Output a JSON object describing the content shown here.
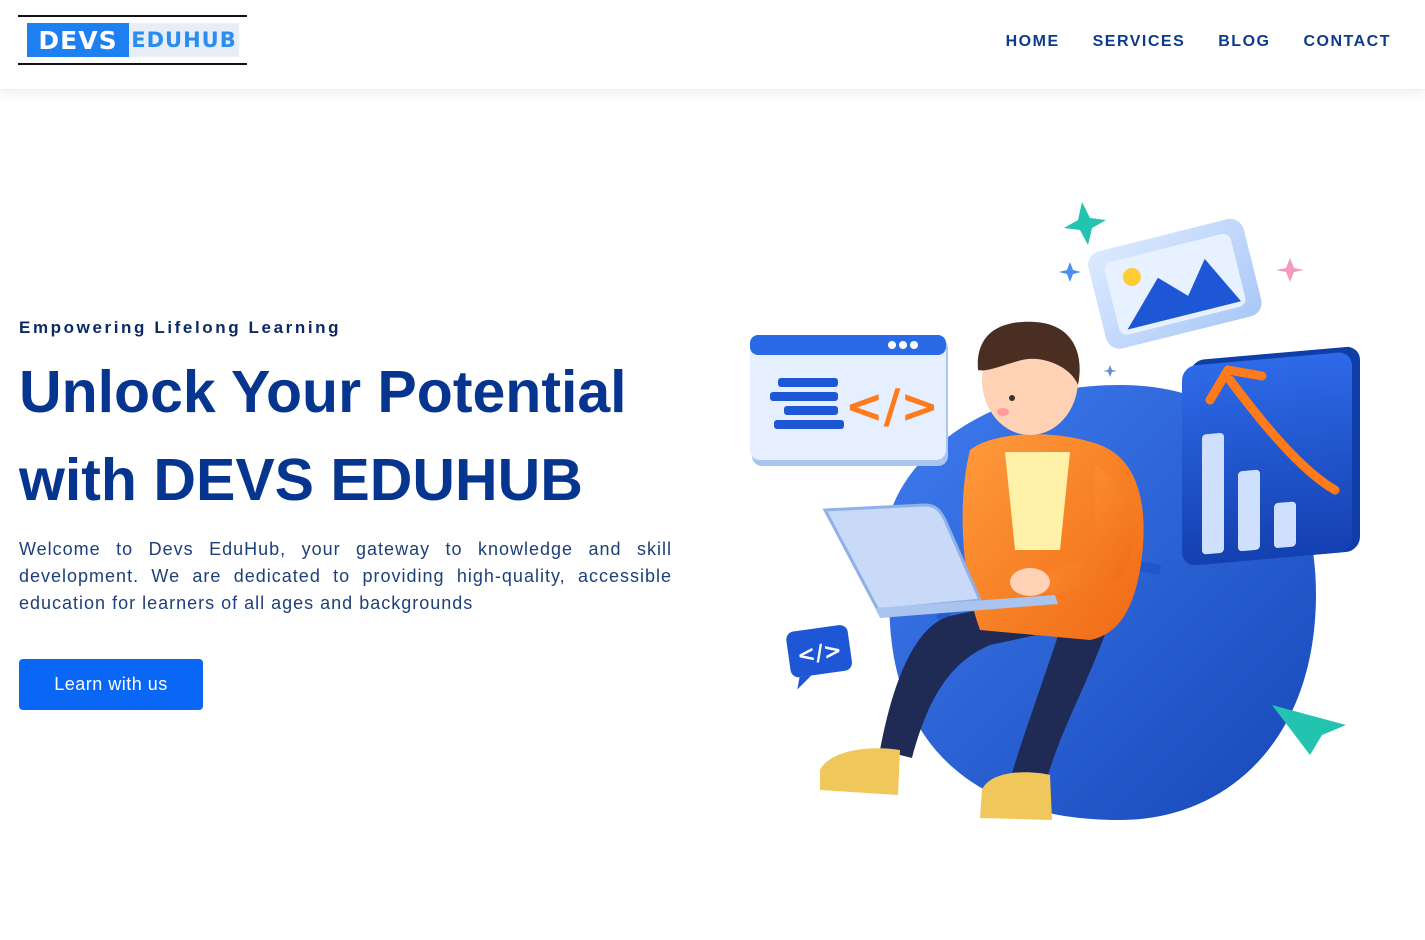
{
  "header": {
    "logo": {
      "part1": "DEVS",
      "part2": "EDUHUB"
    },
    "nav": [
      {
        "label": "HOME"
      },
      {
        "label": "SERVICES"
      },
      {
        "label": "BLOG"
      },
      {
        "label": "CONTACT"
      }
    ]
  },
  "hero": {
    "eyebrow": "Empowering Lifelong Learning",
    "title_line1": "Unlock Your Potential",
    "title_line2": "with DEVS EDUHUB",
    "description": "Welcome to Devs EduHub, your gateway to knowledge and skill development. We are dedicated to providing high-quality, accessible education for learners of all ages and backgrounds",
    "cta_label": "Learn with us"
  },
  "colors": {
    "brand_blue": "#0a66f5",
    "nav_text": "#0d3b8c",
    "heading": "#06358f",
    "accent_orange": "#ff7a1a",
    "accent_teal": "#22c4b0"
  },
  "illustration": {
    "code_window_label": "</>",
    "code_bubble_label": "</>"
  }
}
